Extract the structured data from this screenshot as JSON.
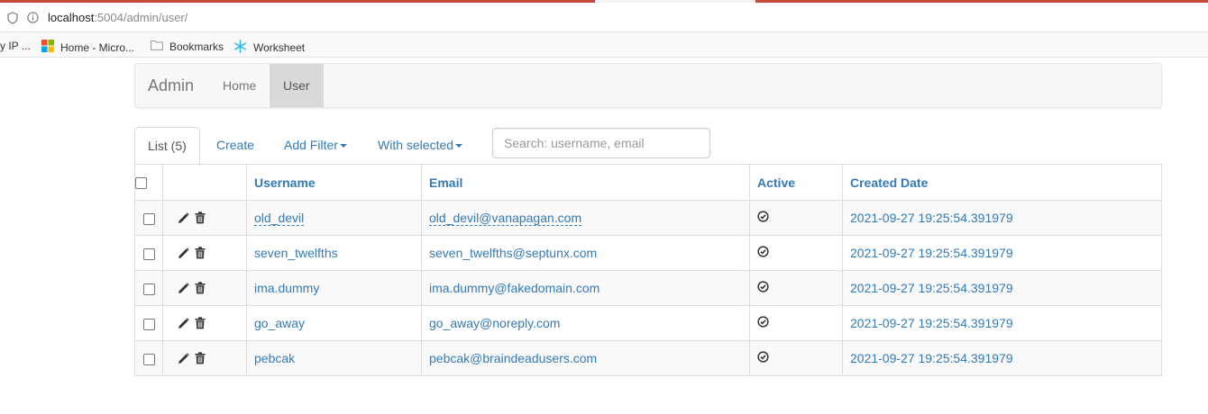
{
  "browser": {
    "url_host": "localhost",
    "url_rest": ":5004/admin/user/",
    "bookmarks": [
      {
        "label": "y IP ...",
        "icon": "none"
      },
      {
        "label": "Home - Micro...",
        "icon": "microsoft-logo-icon"
      },
      {
        "label": "Bookmarks",
        "icon": "folder-icon"
      },
      {
        "label": "Worksheet",
        "icon": "snowflake-icon"
      }
    ]
  },
  "navbar": {
    "brand": "Admin",
    "items": [
      {
        "label": "Home",
        "active": false
      },
      {
        "label": "User",
        "active": true
      }
    ]
  },
  "tabs": {
    "list": "List (5)",
    "create": "Create",
    "add_filter": "Add Filter",
    "with_selected": "With selected"
  },
  "search": {
    "placeholder": "Search: username, email",
    "value": ""
  },
  "table": {
    "columns": [
      "Username",
      "Email",
      "Active",
      "Created Date"
    ],
    "rows": [
      {
        "username": "old_devil",
        "email": "old_devil@vanapagan.com",
        "active": true,
        "created": "2021-09-27 19:25:54.391979",
        "editable": true
      },
      {
        "username": "seven_twelfths",
        "email": "seven_twelfths@septunx.com",
        "active": true,
        "created": "2021-09-27 19:25:54.391979",
        "editable": false
      },
      {
        "username": "ima.dummy",
        "email": "ima.dummy@fakedomain.com",
        "active": true,
        "created": "2021-09-27 19:25:54.391979",
        "editable": false
      },
      {
        "username": "go_away",
        "email": "go_away@noreply.com",
        "active": true,
        "created": "2021-09-27 19:25:54.391979",
        "editable": false
      },
      {
        "username": "pebcak",
        "email": "pebcak@braindeadusers.com",
        "active": true,
        "created": "2021-09-27 19:25:54.391979",
        "editable": false
      }
    ]
  },
  "colors": {
    "link": "#337ab7",
    "active_nav_bg": "#d9d9d9",
    "tab_accent": "#c74a3b"
  }
}
